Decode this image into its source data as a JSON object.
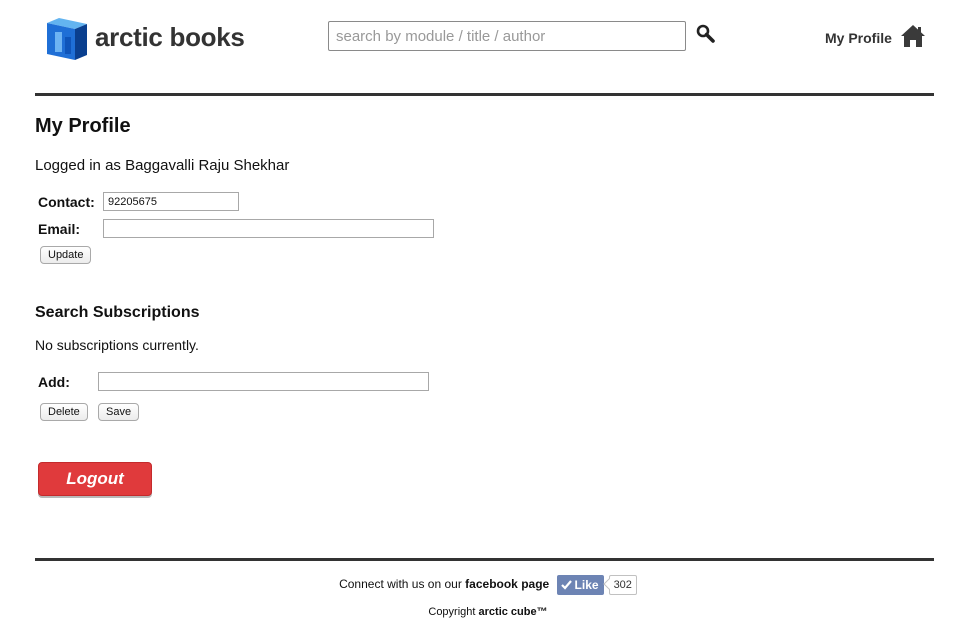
{
  "brand": {
    "name": "arctic books",
    "logo_icon": "blue-cube-logo"
  },
  "header": {
    "search_placeholder": "search by module / title / author",
    "search_value": "",
    "search_icon": "magnifier-icon",
    "profile_link": "My Profile",
    "home_icon": "home-icon"
  },
  "profile": {
    "title": "My Profile",
    "logged_in_text": "Logged in as Baggavalli Raju Shekhar",
    "contact_label": "Contact:",
    "contact_value": "92205675",
    "email_label": "Email:",
    "email_value": "",
    "update_label": "Update"
  },
  "subscriptions": {
    "title": "Search Subscriptions",
    "empty_text": "No subscriptions currently.",
    "add_label": "Add:",
    "add_value": "",
    "delete_label": "Delete",
    "save_label": "Save"
  },
  "logout_label": "Logout",
  "footer": {
    "connect_text": "Connect with us on our",
    "facebook_text": "facebook page",
    "like_label": "Like",
    "like_count": "302",
    "copyright_prefix": "Copyright",
    "copyright_brand": "arctic cube™"
  },
  "colors": {
    "accent_red": "#e03a3c",
    "facebook_blue": "#6d84b4",
    "logo_blue": "#1f6fd6"
  }
}
